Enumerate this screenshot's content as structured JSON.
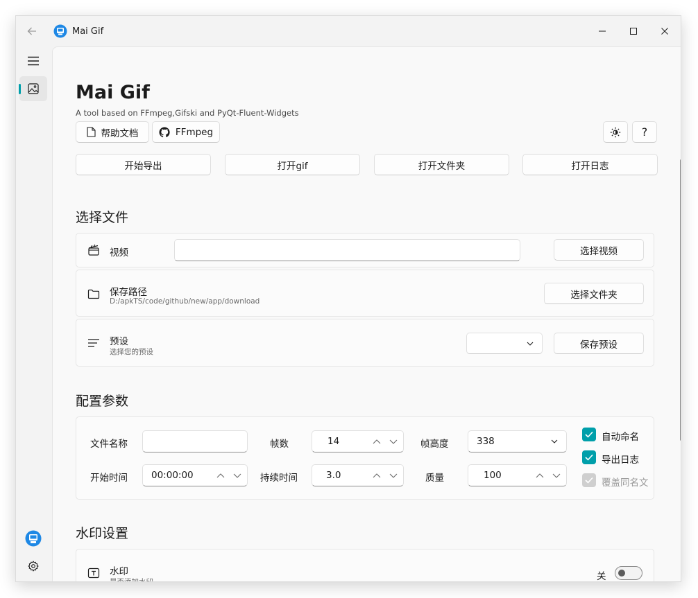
{
  "window": {
    "title": "Mai Gif"
  },
  "colors": {
    "accent": "#009faa",
    "disabled": "#cfcfcf"
  },
  "icons": {
    "back": "arrow-left-icon",
    "logo": "mai-gif-logo-icon",
    "minimize": "minimize-icon",
    "maximize": "maximize-icon",
    "close": "close-icon",
    "menu": "hamburger-menu-icon",
    "image": "image-icon",
    "avatar": "gif-avatar-icon",
    "settings": "gear-icon",
    "doc": "document-icon",
    "github": "github-icon",
    "brightness": "brightness-icon",
    "video": "clapperboard-icon",
    "folder": "folder-icon",
    "preset": "lines-icon",
    "text": "text-box-icon"
  },
  "header": {
    "title": "Mai Gif",
    "subtitle": "A tool based on FFmpeg,Gifski and PyQt-Fluent-Widgets",
    "help_doc": "帮助文档",
    "ffmpeg": "FFmpeg",
    "help_q": "?"
  },
  "actions": {
    "start_export": "开始导出",
    "open_gif": "打开gif",
    "open_folder": "打开文件夹",
    "open_log": "打开日志"
  },
  "select_files": {
    "title": "选择文件",
    "video": {
      "label": "视频",
      "value": "",
      "button": "选择视频"
    },
    "save_path": {
      "label": "保存路径",
      "desc": "D:/apkTS/code/github/new/app/download",
      "button": "选择文件夹"
    },
    "preset": {
      "label": "预设",
      "desc": "选择您的预设",
      "value": "",
      "button": "保存预设"
    }
  },
  "params": {
    "title": "配置参数",
    "file_name": {
      "label": "文件名称",
      "value": ""
    },
    "fps": {
      "label": "帧数",
      "value": "14"
    },
    "frame_height": {
      "label": "帧高度",
      "value": "338"
    },
    "start_time": {
      "label": "开始时间",
      "value": "00:00:00"
    },
    "duration": {
      "label": "持续时间",
      "value": "3.0"
    },
    "quality": {
      "label": "质量",
      "value": "100"
    },
    "auto_name": {
      "label": "自动命名",
      "checked": true
    },
    "export_log": {
      "label": "导出日志",
      "checked": true
    },
    "overwrite": {
      "label": "覆盖同名文",
      "checked": true,
      "disabled": true
    }
  },
  "watermark": {
    "title": "水印设置",
    "label": "水印",
    "desc": "是否添加水印",
    "state_label": "关",
    "enabled": false
  }
}
